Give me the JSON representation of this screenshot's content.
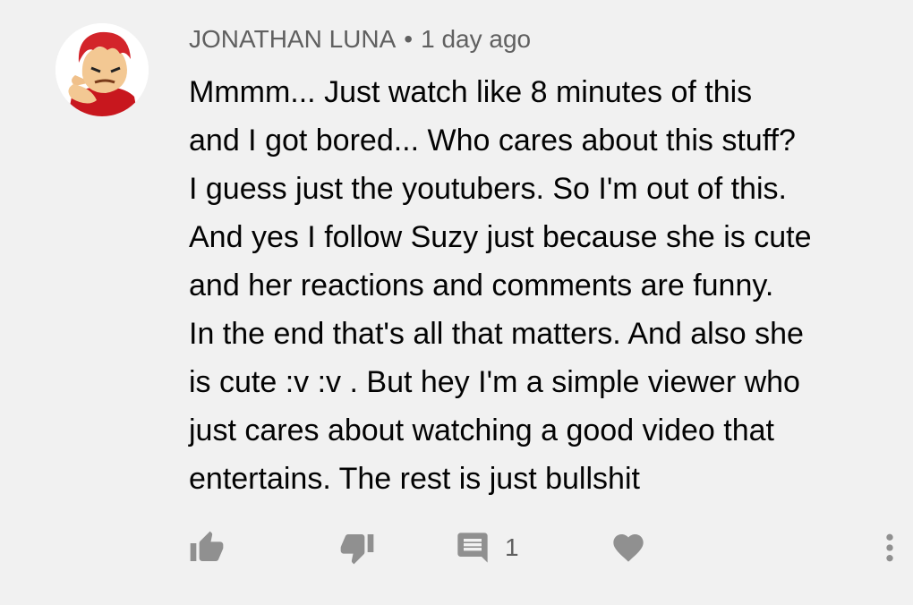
{
  "comment": {
    "author": "JONATHAN LUNA",
    "separator": "•",
    "time": "1 day ago",
    "lines": [
      "Mmmm... Just watch like 8 minutes of this",
      "and I got bored... Who cares about this stuff?",
      "I guess just the youtubers. So I'm out of this.",
      "And yes I follow Suzy just because she is cute",
      "and her reactions and comments are funny.",
      "In the end that's all that matters. And also she",
      "is cute  :v :v . But hey I'm a simple viewer who",
      "just cares about watching a good video that",
      "entertains. The rest is just bullshit"
    ]
  },
  "actions": {
    "reply_count": "1",
    "icons": [
      "thumbs-up-icon",
      "thumbs-down-icon",
      "reply-icon",
      "heart-icon",
      "more-vert-icon"
    ]
  },
  "colors": {
    "background": "#f1f1f1",
    "icon": "#909090",
    "meta_text": "#606060",
    "body_text": "#030303"
  }
}
